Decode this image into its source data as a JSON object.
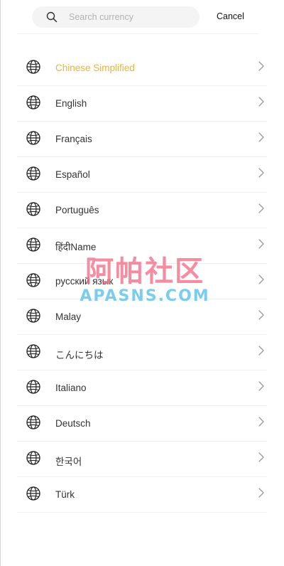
{
  "search": {
    "placeholder": "Search currency",
    "value": "",
    "icon": "search-icon"
  },
  "header": {
    "cancel_label": "Cancel"
  },
  "languages": {
    "selected_color": "#ebb436",
    "row_icon": "globe-icon",
    "trailing_icon": "chevron-right-icon",
    "items": [
      {
        "label": "Chinese Simplified",
        "selected": true
      },
      {
        "label": "English",
        "selected": false
      },
      {
        "label": "Français",
        "selected": false
      },
      {
        "label": "Español",
        "selected": false
      },
      {
        "label": "Português",
        "selected": false
      },
      {
        "label": "हिंदीName",
        "selected": false
      },
      {
        "label": "русский язык",
        "selected": false
      },
      {
        "label": "Malay",
        "selected": false
      },
      {
        "label": "こんにちは",
        "selected": false
      },
      {
        "label": "Italiano",
        "selected": false
      },
      {
        "label": "Deutsch",
        "selected": false
      },
      {
        "label": "한국어",
        "selected": false
      },
      {
        "label": "Türk",
        "selected": false
      }
    ]
  },
  "watermark": {
    "line1": "阿帕社区",
    "line2": "APASNS.COM"
  }
}
